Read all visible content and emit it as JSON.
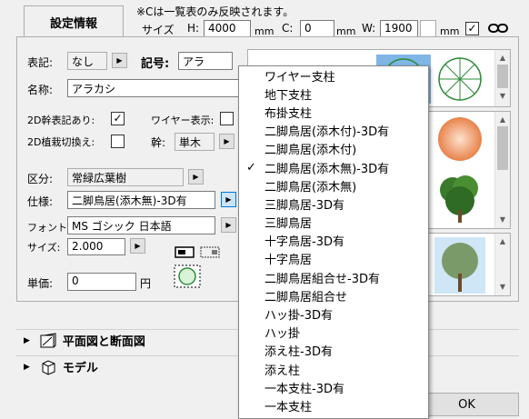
{
  "tab": {
    "label": "設定情報"
  },
  "note": "※Cは一覧表のみ反映されます。",
  "size": {
    "label": "サイズ",
    "h_label": "H:",
    "h_value": "4000",
    "h_unit": "mm",
    "c_label": "C:",
    "c_value": "0",
    "c_unit": "mm",
    "w_label": "W:",
    "w_value": "1900",
    "w_unit": "mm",
    "checked": true
  },
  "form": {
    "notation_label": "表記:",
    "notation_value": "なし",
    "symbol_label": "記号:",
    "symbol_value": "アラ",
    "name_label": "名称:",
    "name_value": "アラカシ",
    "trunk2d_label": "2D幹表記あり:",
    "trunk2d_checked": true,
    "wire_label": "ワイヤー表示:",
    "wire_checked": false,
    "plant2d_label": "2D植栽切換え:",
    "plant2d_checked": false,
    "trunk_label": "幹:",
    "trunk_value": "単木",
    "category_label": "区分:",
    "category_value": "常緑広葉樹",
    "spec_label": "仕様:",
    "spec_value": "二脚鳥居(添木無)-3D有",
    "font_label": "フォント:",
    "font_value": "MS ゴシック 日本語",
    "fontsize_label": "サイズ:",
    "fontsize_value": "2.000",
    "price_label": "単価:",
    "price_value": "0",
    "price_unit": "円"
  },
  "sections": [
    {
      "label": "平面図と断面図"
    },
    {
      "label": "モデル"
    }
  ],
  "dropdown": {
    "items": [
      {
        "label": "ワイヤー支柱",
        "checked": false
      },
      {
        "label": "地下支柱",
        "checked": false
      },
      {
        "label": "布掛支柱",
        "checked": false
      },
      {
        "label": "二脚鳥居(添木付)-3D有",
        "checked": false
      },
      {
        "label": "二脚鳥居(添木付)",
        "checked": false
      },
      {
        "label": "二脚鳥居(添木無)-3D有",
        "checked": true
      },
      {
        "label": "二脚鳥居(添木無)",
        "checked": false
      },
      {
        "label": "三脚鳥居-3D有",
        "checked": false
      },
      {
        "label": "三脚鳥居",
        "checked": false
      },
      {
        "label": "十字鳥居-3D有",
        "checked": false
      },
      {
        "label": "十字鳥居",
        "checked": false
      },
      {
        "label": "二脚鳥居組合せ-3D有",
        "checked": false
      },
      {
        "label": "二脚鳥居組合せ",
        "checked": false
      },
      {
        "label": "ハッ掛-3D有",
        "checked": false
      },
      {
        "label": "ハッ掛",
        "checked": false
      },
      {
        "label": "添え柱-3D有",
        "checked": false
      },
      {
        "label": "添え柱",
        "checked": false
      },
      {
        "label": "一本支柱-3D有",
        "checked": false
      },
      {
        "label": "一本支柱",
        "checked": false
      }
    ],
    "check_glyph": "✓"
  },
  "ok_button": {
    "label": "OK"
  },
  "colors": {
    "highlight": "#0078d7",
    "plant_green": "#2e8b3a",
    "plant_orange": "#e8834a"
  },
  "icons": [
    "expand-arrow-icon",
    "section-icon",
    "cube-icon",
    "link-icon",
    "plant-symbol-icon"
  ]
}
